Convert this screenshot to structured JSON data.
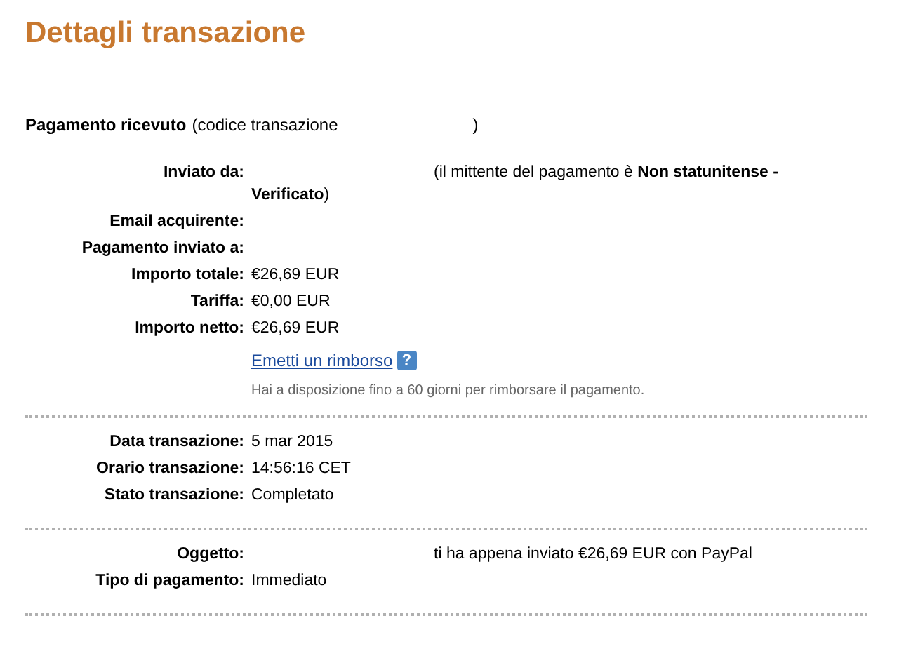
{
  "title": "Dettagli transazione",
  "receipt": {
    "label": "Pagamento ricevuto",
    "text": "(codice transazione",
    "tail": ")"
  },
  "sections": [
    {
      "rows": [
        {
          "label": "Inviato da:",
          "kind": "after_hidden",
          "value": "(il mittente del pagamento è **Non statunitense - Verificato**)"
        },
        {
          "label": "Email acquirente:"
        },
        {
          "label": "Pagamento inviato a:"
        },
        {
          "label": "Importo totale:",
          "kind": "plain",
          "value": "€26,69 EUR"
        },
        {
          "label": "Tariffa:",
          "kind": "plain",
          "value": "€0,00 EUR"
        },
        {
          "label": "Importo netto:",
          "kind": "plain",
          "value": "€26,69 EUR"
        }
      ],
      "refund": {
        "link": "Emetti un rimborso",
        "help": "?",
        "note": "Hai a disposizione fino a 60 giorni per rimborsare il pagamento."
      }
    },
    {
      "rows": [
        {
          "label": "Data transazione:",
          "kind": "plain",
          "value": "5 mar 2015"
        },
        {
          "label": "Orario transazione:",
          "kind": "plain",
          "value": "14:56:16 CET"
        },
        {
          "label": "Stato transazione:",
          "kind": "plain",
          "value": "Completato"
        }
      ]
    },
    {
      "rows": [
        {
          "label": "Oggetto:",
          "kind": "after_hidden",
          "value": "ti ha appena inviato €26,69 EUR con PayPal"
        },
        {
          "label": "Tipo di pagamento:",
          "kind": "plain",
          "value": "Immediato"
        }
      ]
    }
  ]
}
